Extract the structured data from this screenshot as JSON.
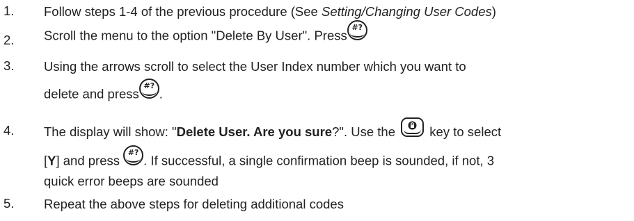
{
  "steps": [
    {
      "number": "1.",
      "text_a": "Follow steps 1-4 of the previous procedure (See ",
      "ref": "Setting/Changing User Codes",
      "text_b": ")"
    },
    {
      "number": "2.",
      "text_a": "Scroll the menu to the option \"Delete By User\". Press"
    },
    {
      "number": "3.",
      "line1": "Using the arrows scroll to select the User Index number which you want to",
      "line2_a": "delete and press",
      "line2_b": "."
    },
    {
      "number": "4.",
      "line1_a": "The display will show: \"",
      "display_text": "Delete User. Are you sure",
      "line1_b": "?\".  Use the",
      "line1_c": "key to select",
      "line2_a": "[",
      "line2_y": "Y",
      "line2_b": "] and press",
      "line2_c": ". If successful, a single confirmation beep is sounded, if not, 3",
      "line3": "quick error beeps are sounded"
    },
    {
      "number": "5.",
      "text": "Repeat the above steps for deleting additional codes"
    }
  ],
  "icons": {
    "enter_key": {
      "name": "hash-question-key-icon",
      "glyph": "#?"
    },
    "select_key": {
      "name": "lock-key-icon"
    }
  }
}
